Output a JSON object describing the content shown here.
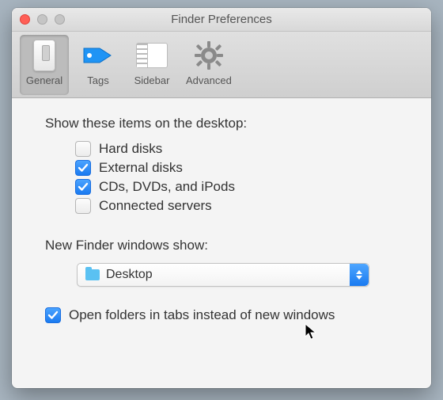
{
  "window": {
    "title": "Finder Preferences"
  },
  "toolbar": {
    "items": [
      {
        "label": "General",
        "selected": true
      },
      {
        "label": "Tags",
        "selected": false
      },
      {
        "label": "Sidebar",
        "selected": false
      },
      {
        "label": "Advanced",
        "selected": false
      }
    ]
  },
  "general": {
    "desktop_items_heading": "Show these items on the desktop:",
    "desktop_items": [
      {
        "label": "Hard disks",
        "checked": false
      },
      {
        "label": "External disks",
        "checked": true
      },
      {
        "label": "CDs, DVDs, and iPods",
        "checked": true
      },
      {
        "label": "Connected servers",
        "checked": false
      }
    ],
    "new_windows_heading": "New Finder windows show:",
    "new_windows_value": "Desktop",
    "open_in_tabs": {
      "label": "Open folders in tabs instead of new windows",
      "checked": true
    }
  }
}
